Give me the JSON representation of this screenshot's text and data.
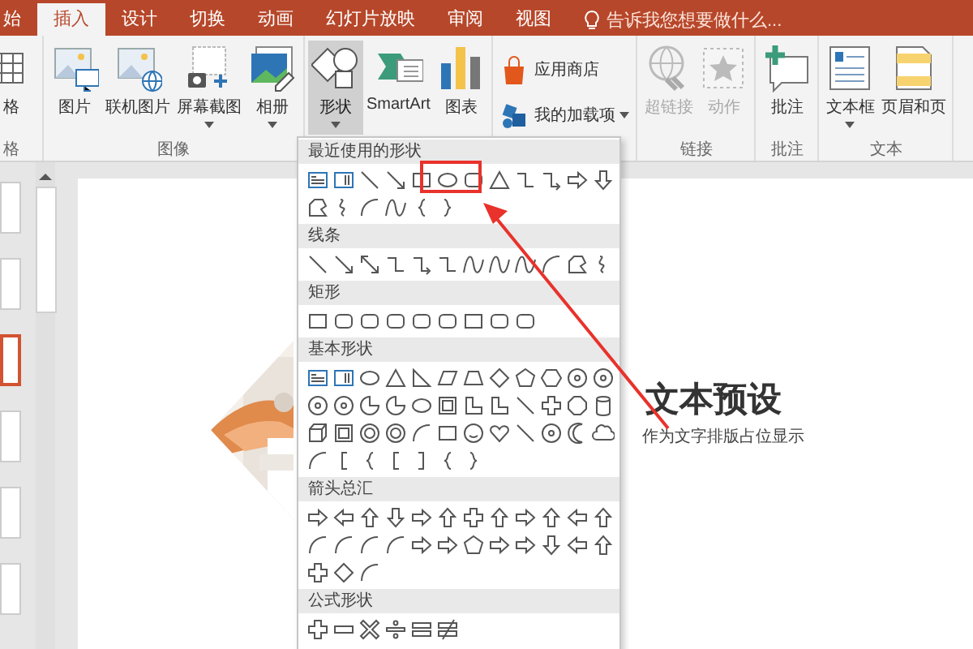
{
  "tabs": [
    {
      "label": "始",
      "selected": false
    },
    {
      "label": "插入",
      "selected": true
    },
    {
      "label": "设计",
      "selected": false
    },
    {
      "label": "切换",
      "selected": false
    },
    {
      "label": "动画",
      "selected": false
    },
    {
      "label": "幻灯片放映",
      "selected": false
    },
    {
      "label": "审阅",
      "selected": false
    },
    {
      "label": "视图",
      "selected": false
    }
  ],
  "tell_me": {
    "placeholder": "告诉我您想要做什么..."
  },
  "ribbon": {
    "groups": [
      {
        "label": "格",
        "buttons": [
          {
            "label": "格",
            "kind": "large",
            "caret": false,
            "selected": false,
            "disabled": false
          }
        ]
      },
      {
        "label": "图像",
        "buttons": [
          {
            "label": "图片",
            "kind": "large",
            "caret": false,
            "selected": false,
            "disabled": false
          },
          {
            "label": "联机图片",
            "kind": "large",
            "caret": false,
            "selected": false,
            "disabled": false
          },
          {
            "label": "屏幕截图",
            "kind": "large",
            "caret": true,
            "selected": false,
            "disabled": false
          },
          {
            "label": "相册",
            "kind": "large",
            "caret": true,
            "selected": false,
            "disabled": false
          }
        ]
      },
      {
        "buttons": [
          {
            "label": "形状",
            "kind": "large",
            "caret": true,
            "selected": true,
            "disabled": false
          },
          {
            "label": "SmartArt",
            "kind": "large",
            "caret": false,
            "selected": false,
            "disabled": false
          },
          {
            "label": "图表",
            "kind": "large",
            "caret": false,
            "selected": false,
            "disabled": false
          }
        ]
      },
      {
        "buttons": [
          {
            "label": "应用商店",
            "kind": "small",
            "caret": false,
            "selected": false,
            "disabled": false
          },
          {
            "label": "我的加载项",
            "kind": "small",
            "caret": true,
            "selected": false,
            "disabled": false
          }
        ]
      },
      {
        "label": "链接",
        "buttons": [
          {
            "label": "超链接",
            "kind": "large",
            "caret": false,
            "selected": false,
            "disabled": true
          },
          {
            "label": "动作",
            "kind": "large",
            "caret": false,
            "selected": false,
            "disabled": true
          }
        ]
      },
      {
        "label": "批注",
        "buttons": [
          {
            "label": "批注",
            "kind": "large",
            "caret": false,
            "selected": false,
            "disabled": false
          }
        ]
      },
      {
        "label": "文本",
        "buttons": [
          {
            "label": "文本框",
            "kind": "large",
            "caret": true,
            "selected": false,
            "disabled": false
          },
          {
            "label": "页眉和页",
            "kind": "large",
            "caret": false,
            "selected": false,
            "disabled": false
          }
        ]
      }
    ]
  },
  "slides": [
    {
      "selected": false
    },
    {
      "selected": false
    },
    {
      "selected": true
    },
    {
      "selected": false
    },
    {
      "selected": false
    },
    {
      "selected": false
    }
  ],
  "slide": {
    "title": "文本预设",
    "subtitle": "作为文字排版占位显示"
  },
  "shapes_menu": {
    "sections": [
      {
        "title": "最近使用的形状"
      },
      {
        "title": "线条"
      },
      {
        "title": "矩形"
      },
      {
        "title": "基本形状"
      },
      {
        "title": "箭头总汇"
      },
      {
        "title": "公式形状"
      }
    ]
  }
}
